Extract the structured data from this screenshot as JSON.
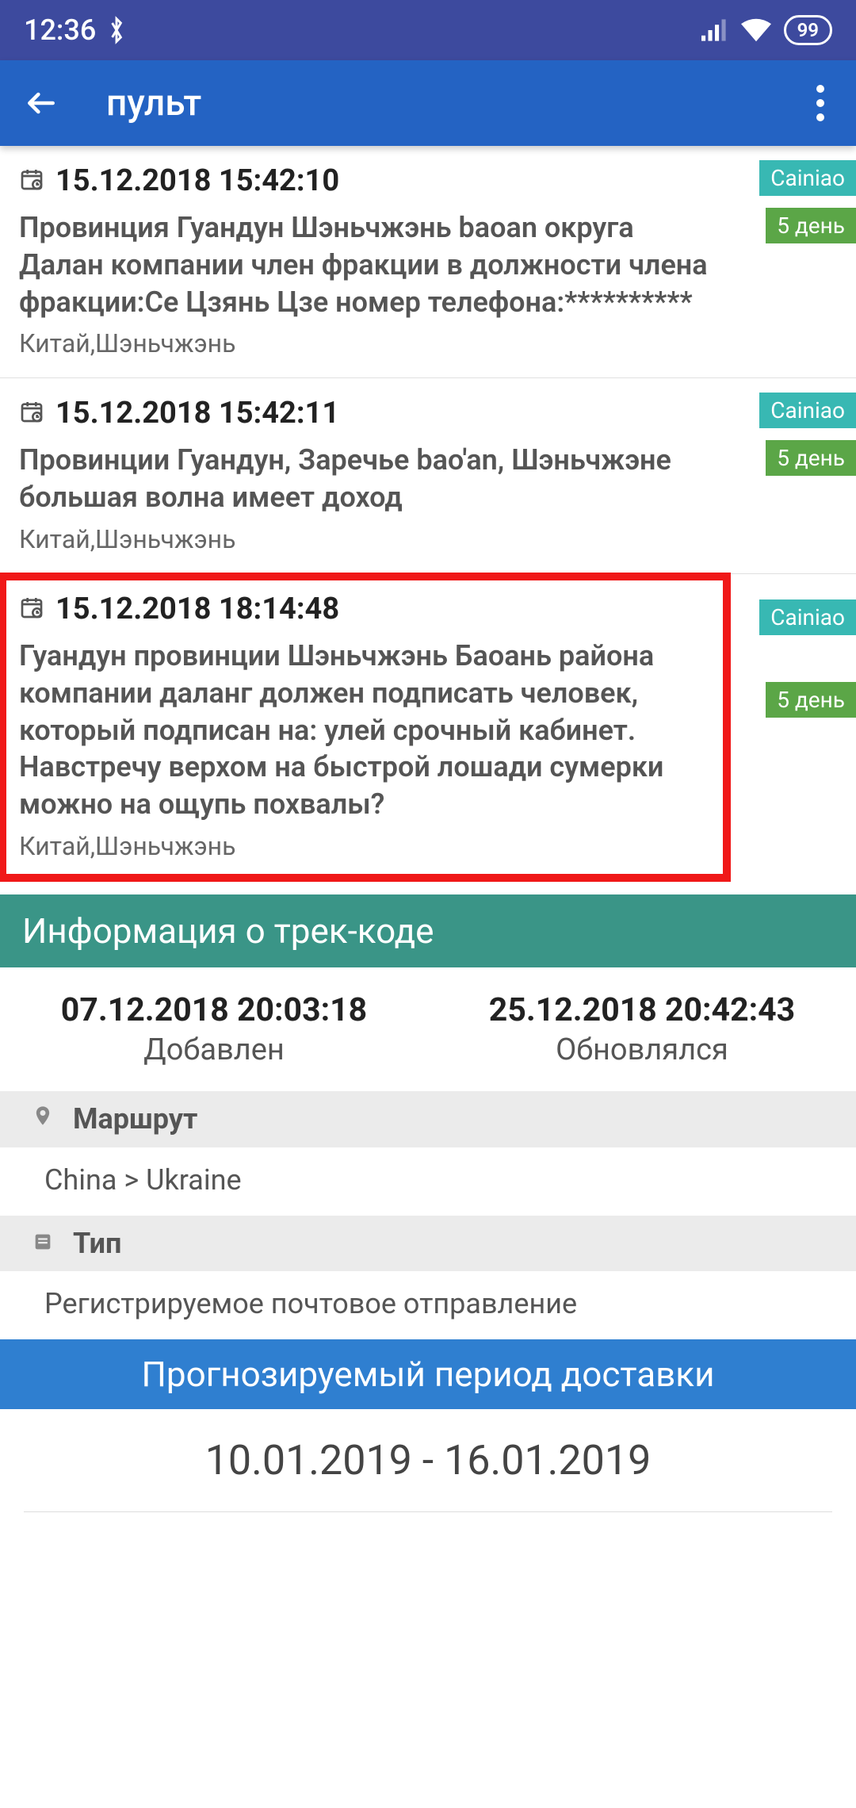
{
  "status": {
    "time": "12:36",
    "battery": "99"
  },
  "appbar": {
    "title": "пульт"
  },
  "events": [
    {
      "date": "15.12.2018 15:42:10",
      "body": "Провинция Гуандун Шэньчжэнь baoan округа Далан компании член фракции в должности члена фракции:Се Цзянь Цзе номер телефона:**********",
      "loc": "Китай,Шэньчжэнь",
      "carrier": "Cainiao",
      "days": "5 день"
    },
    {
      "date": "15.12.2018 15:42:11",
      "body": "Провинции Гуандун, Заречье bao'an, Шэньчжэне большая волна имеет доход",
      "loc": "Китай,Шэньчжэнь",
      "carrier": "Cainiao",
      "days": "5 день"
    },
    {
      "date": "15.12.2018 18:14:48",
      "body": "Гуандун провинции Шэньчжэнь Баоань района компании даланг должен подписать человек, который подписан на: улей срочный кабинет. Навстречу верхом на быстрой лошади сумерки можно на ощупь похвалы?",
      "loc": "Китай,Шэньчжэнь",
      "carrier": "Cainiao",
      "days": "5 день"
    }
  ],
  "info": {
    "section_title": "Информация о трек-коде",
    "added_val": "07.12.2018 20:03:18",
    "added_label": "Добавлен",
    "updated_val": "25.12.2018 20:42:43",
    "updated_label": "Обновлялся",
    "route_label": "Маршрут",
    "route_value": "China > Ukraine",
    "type_label": "Тип",
    "type_value": "Регистрируемое почтовое отправление"
  },
  "forecast": {
    "title": "Прогнозируемый период доставки",
    "value": "10.01.2019 - 16.01.2019"
  }
}
